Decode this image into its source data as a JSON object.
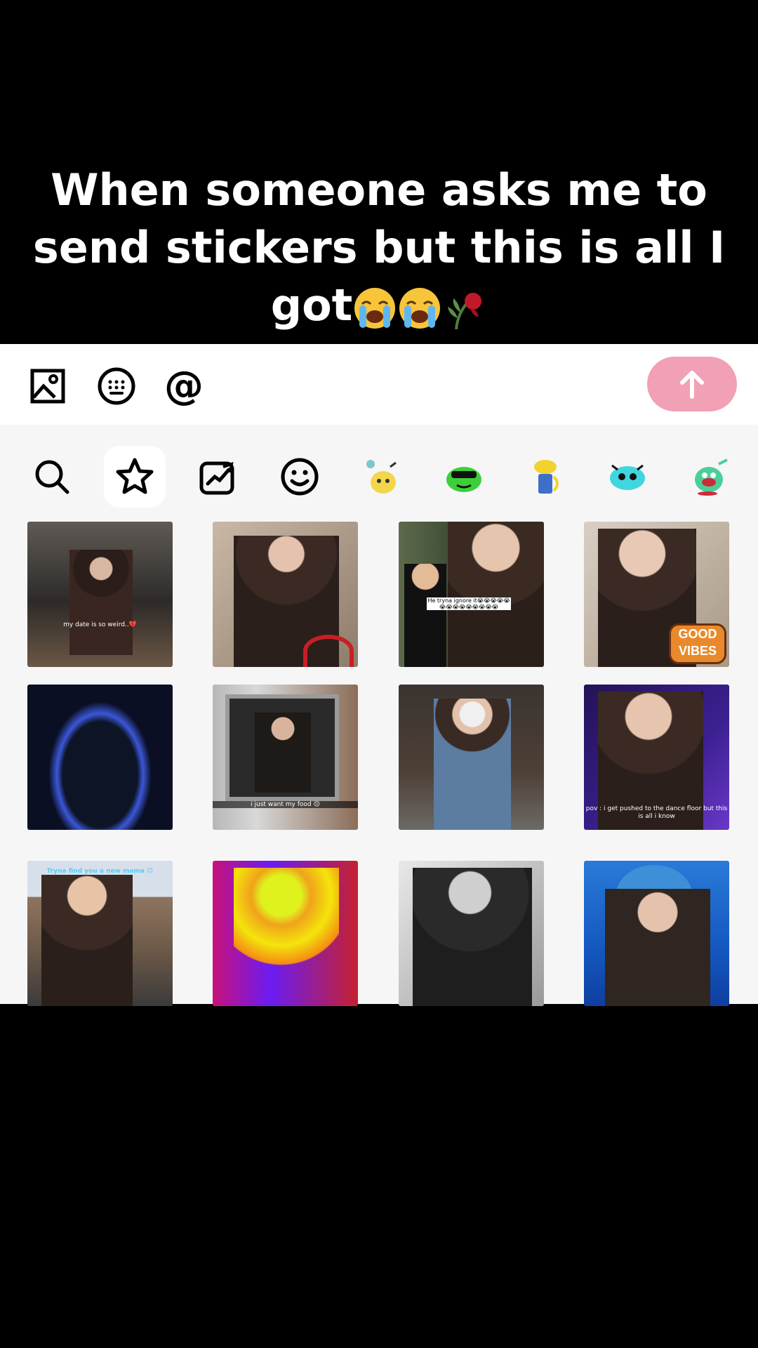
{
  "caption": {
    "line1": "When someone asks me to",
    "line2": "send stickers but this is all I",
    "line3": "got"
  },
  "toolbar": {
    "icons": [
      "image-icon",
      "keyboard-icon",
      "at-icon"
    ],
    "at_symbol": "@",
    "send_icon": "arrow-up-icon",
    "send_color": "#f2a0b5"
  },
  "tabs": [
    {
      "icon": "search-icon"
    },
    {
      "icon": "star-icon",
      "active": true
    },
    {
      "icon": "trending-icon"
    },
    {
      "icon": "smiley-icon"
    },
    {
      "icon": "sticker-pack-yellow-creature-icon"
    },
    {
      "icon": "sticker-pack-green-frog-icon"
    },
    {
      "icon": "sticker-pack-yellow-flower-icon"
    },
    {
      "icon": "sticker-pack-blue-face-icon"
    },
    {
      "icon": "sticker-pack-green-creature-icon"
    }
  ],
  "stickers": [
    {
      "name": "restaurant-sticker",
      "caption": "my date is so weird..💔"
    },
    {
      "name": "stairs-dance-sticker",
      "caption": ""
    },
    {
      "name": "ignore-sticker",
      "caption": "He tryna ignore it😭😭😭😭😭😭😭😭😭😭😭😭😭😭"
    },
    {
      "name": "good-vibes-sticker",
      "caption": "GOOD VIBES"
    },
    {
      "name": "blue-flame-silhouette-sticker",
      "caption": ""
    },
    {
      "name": "window-sticker",
      "caption": "i just want my food 😔"
    },
    {
      "name": "overalls-sticker",
      "caption": ""
    },
    {
      "name": "dance-floor-sticker",
      "caption": "pov : i get pushed to the dance floor but this is all i know"
    },
    {
      "name": "outdoor-sticker",
      "caption": "Tryna find you a new mama 😊"
    },
    {
      "name": "thermal-sticker",
      "caption": ""
    },
    {
      "name": "grayscale-sticker",
      "caption": ""
    },
    {
      "name": "shark-hat-sticker",
      "caption": ""
    }
  ]
}
